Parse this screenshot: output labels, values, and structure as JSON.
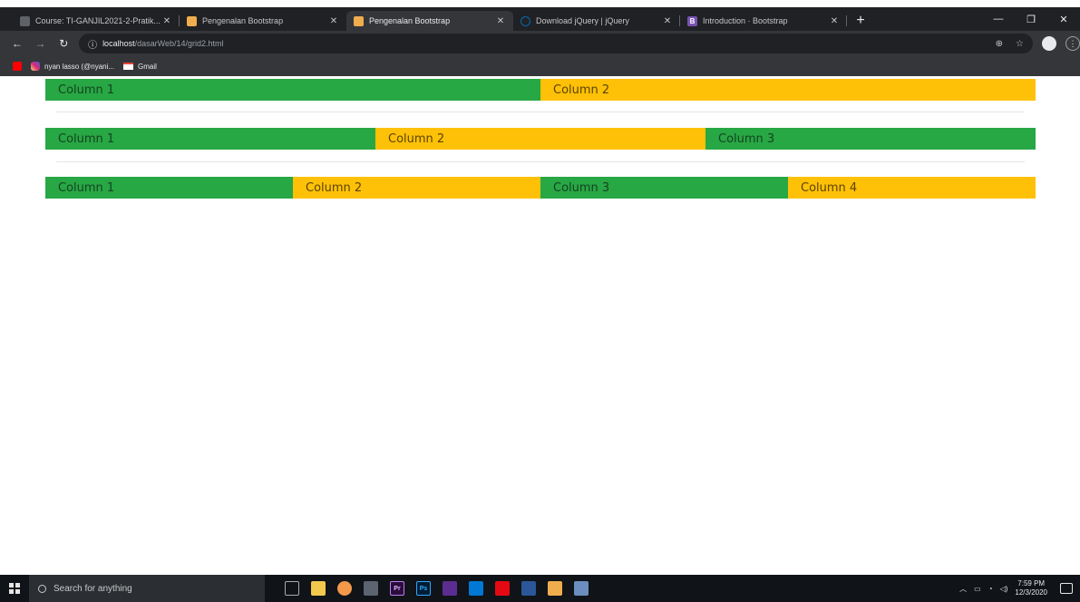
{
  "browser": {
    "tabs": [
      {
        "title": "Course: TI-GANJIL2021-2-Pratik...",
        "favicon": "moodle-icon",
        "color": "#3c4043",
        "active": false
      },
      {
        "title": "Pengenalan Bootstrap",
        "favicon": "html-icon",
        "color": "#f0ad4e",
        "active": false
      },
      {
        "title": "Pengenalan Bootstrap",
        "favicon": "html-icon",
        "color": "#f0ad4e",
        "active": true
      },
      {
        "title": "Download jQuery | jQuery",
        "favicon": "jquery-icon",
        "color": "#0769ad",
        "active": false
      },
      {
        "title": "Introduction · Bootstrap",
        "favicon": "bootstrap-icon",
        "color": "#7952b3",
        "active": false
      }
    ],
    "new_tab": "+",
    "address": {
      "host": "localhost",
      "path": "/dasarWeb/14/grid2.html"
    },
    "bookmarks": [
      {
        "label": "nyan lasso (@nyani...",
        "icon": "instagram-icon"
      },
      {
        "label": "Gmail",
        "icon": "gmail-icon"
      }
    ]
  },
  "page": {
    "rows": [
      {
        "columns": [
          {
            "label": "Column 1",
            "color": "#28a745"
          },
          {
            "label": "Column 2",
            "color": "#ffc107"
          }
        ]
      },
      {
        "columns": [
          {
            "label": "Column 1",
            "color": "#28a745"
          },
          {
            "label": "Column 2",
            "color": "#ffc107"
          },
          {
            "label": "Column 3",
            "color": "#28a745"
          }
        ]
      },
      {
        "columns": [
          {
            "label": "Column 1",
            "color": "#28a745"
          },
          {
            "label": "Column 2",
            "color": "#ffc107"
          },
          {
            "label": "Column 3",
            "color": "#28a745"
          },
          {
            "label": "Column 4",
            "color": "#ffc107"
          }
        ]
      }
    ]
  },
  "taskbar": {
    "search_placeholder": "Search for anything",
    "time": "7:59 PM",
    "date": "12/3/2020"
  }
}
